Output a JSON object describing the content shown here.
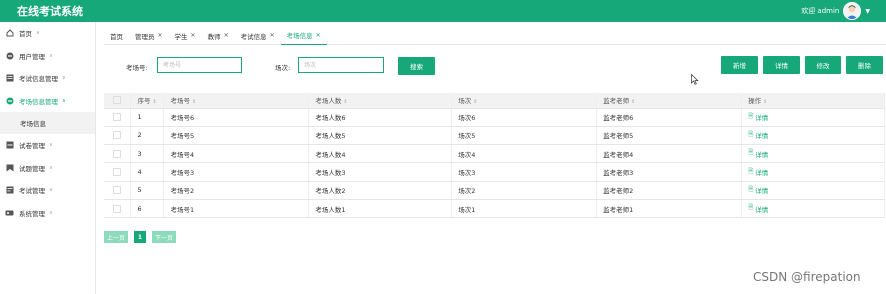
{
  "app": {
    "title": "在线考试系统",
    "welcome": "欢迎 admin"
  },
  "sidebar": {
    "items": [
      {
        "label": "首页",
        "icon": "home-icon"
      },
      {
        "label": "用户管理",
        "icon": "user-icon"
      },
      {
        "label": "考试信息管理",
        "icon": "list-icon"
      },
      {
        "label": "考场信息管理",
        "icon": "room-icon",
        "active": true
      },
      {
        "label": "试卷管理",
        "icon": "paper-icon"
      },
      {
        "label": "试题管理",
        "icon": "question-icon"
      },
      {
        "label": "考试管理",
        "icon": "exam-icon"
      },
      {
        "label": "系统管理",
        "icon": "system-icon"
      }
    ],
    "sub_item": "考场信息"
  },
  "tabs": [
    {
      "label": "首页",
      "closable": false
    },
    {
      "label": "管理员",
      "closable": true
    },
    {
      "label": "学生",
      "closable": true
    },
    {
      "label": "教师",
      "closable": true
    },
    {
      "label": "考试信息",
      "closable": true
    },
    {
      "label": "考场信息",
      "closable": true,
      "active": true
    }
  ],
  "search": {
    "room_label": "考场号:",
    "room_placeholder": "考场号",
    "session_label": "场次:",
    "session_placeholder": "场次",
    "search_button": "搜索"
  },
  "actions": {
    "add": "新增",
    "detail": "详情",
    "edit": "修改",
    "delete": "删除"
  },
  "table": {
    "headers": [
      "序号",
      "考场号",
      "考场人数",
      "场次",
      "监考老师",
      "操作"
    ],
    "rows": [
      [
        "1",
        "考场号6",
        "考场人数6",
        "场次6",
        "监考老师6",
        "详情"
      ],
      [
        "2",
        "考场号5",
        "考场人数5",
        "场次5",
        "监考老师5",
        "详情"
      ],
      [
        "3",
        "考场号4",
        "考场人数4",
        "场次4",
        "监考老师4",
        "详情"
      ],
      [
        "4",
        "考场号3",
        "考场人数3",
        "场次3",
        "监考老师3",
        "详情"
      ],
      [
        "5",
        "考场号2",
        "考场人数2",
        "场次2",
        "监考老师2",
        "详情"
      ],
      [
        "6",
        "考场号1",
        "考场人数1",
        "场次1",
        "监考老师1",
        "详情"
      ]
    ]
  },
  "pager": {
    "prev": "上一页",
    "current": "1",
    "next": "下一页"
  },
  "watermark": "CSDN @firepation",
  "colors": {
    "accent": "#16a878",
    "pager_disabled": "#8ddbbd"
  }
}
